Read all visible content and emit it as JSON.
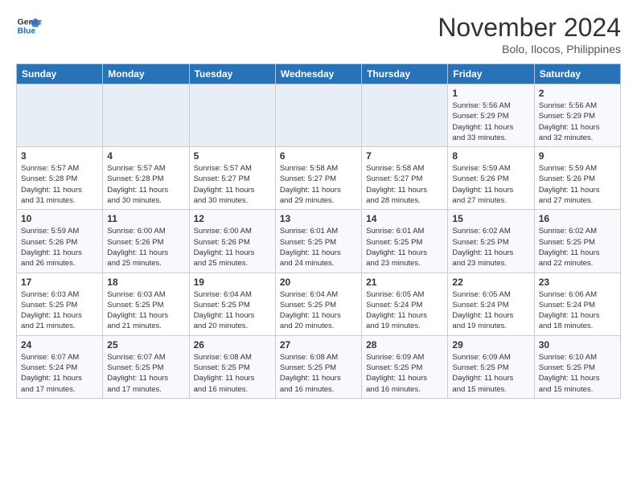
{
  "logo": {
    "line1": "General",
    "line2": "Blue"
  },
  "title": "November 2024",
  "subtitle": "Bolo, Ilocos, Philippines",
  "weekdays": [
    "Sunday",
    "Monday",
    "Tuesday",
    "Wednesday",
    "Thursday",
    "Friday",
    "Saturday"
  ],
  "weeks": [
    [
      {
        "day": "",
        "info": ""
      },
      {
        "day": "",
        "info": ""
      },
      {
        "day": "",
        "info": ""
      },
      {
        "day": "",
        "info": ""
      },
      {
        "day": "",
        "info": ""
      },
      {
        "day": "1",
        "info": "Sunrise: 5:56 AM\nSunset: 5:29 PM\nDaylight: 11 hours\nand 33 minutes."
      },
      {
        "day": "2",
        "info": "Sunrise: 5:56 AM\nSunset: 5:29 PM\nDaylight: 11 hours\nand 32 minutes."
      }
    ],
    [
      {
        "day": "3",
        "info": "Sunrise: 5:57 AM\nSunset: 5:28 PM\nDaylight: 11 hours\nand 31 minutes."
      },
      {
        "day": "4",
        "info": "Sunrise: 5:57 AM\nSunset: 5:28 PM\nDaylight: 11 hours\nand 30 minutes."
      },
      {
        "day": "5",
        "info": "Sunrise: 5:57 AM\nSunset: 5:27 PM\nDaylight: 11 hours\nand 30 minutes."
      },
      {
        "day": "6",
        "info": "Sunrise: 5:58 AM\nSunset: 5:27 PM\nDaylight: 11 hours\nand 29 minutes."
      },
      {
        "day": "7",
        "info": "Sunrise: 5:58 AM\nSunset: 5:27 PM\nDaylight: 11 hours\nand 28 minutes."
      },
      {
        "day": "8",
        "info": "Sunrise: 5:59 AM\nSunset: 5:26 PM\nDaylight: 11 hours\nand 27 minutes."
      },
      {
        "day": "9",
        "info": "Sunrise: 5:59 AM\nSunset: 5:26 PM\nDaylight: 11 hours\nand 27 minutes."
      }
    ],
    [
      {
        "day": "10",
        "info": "Sunrise: 5:59 AM\nSunset: 5:26 PM\nDaylight: 11 hours\nand 26 minutes."
      },
      {
        "day": "11",
        "info": "Sunrise: 6:00 AM\nSunset: 5:26 PM\nDaylight: 11 hours\nand 25 minutes."
      },
      {
        "day": "12",
        "info": "Sunrise: 6:00 AM\nSunset: 5:26 PM\nDaylight: 11 hours\nand 25 minutes."
      },
      {
        "day": "13",
        "info": "Sunrise: 6:01 AM\nSunset: 5:25 PM\nDaylight: 11 hours\nand 24 minutes."
      },
      {
        "day": "14",
        "info": "Sunrise: 6:01 AM\nSunset: 5:25 PM\nDaylight: 11 hours\nand 23 minutes."
      },
      {
        "day": "15",
        "info": "Sunrise: 6:02 AM\nSunset: 5:25 PM\nDaylight: 11 hours\nand 23 minutes."
      },
      {
        "day": "16",
        "info": "Sunrise: 6:02 AM\nSunset: 5:25 PM\nDaylight: 11 hours\nand 22 minutes."
      }
    ],
    [
      {
        "day": "17",
        "info": "Sunrise: 6:03 AM\nSunset: 5:25 PM\nDaylight: 11 hours\nand 21 minutes."
      },
      {
        "day": "18",
        "info": "Sunrise: 6:03 AM\nSunset: 5:25 PM\nDaylight: 11 hours\nand 21 minutes."
      },
      {
        "day": "19",
        "info": "Sunrise: 6:04 AM\nSunset: 5:25 PM\nDaylight: 11 hours\nand 20 minutes."
      },
      {
        "day": "20",
        "info": "Sunrise: 6:04 AM\nSunset: 5:25 PM\nDaylight: 11 hours\nand 20 minutes."
      },
      {
        "day": "21",
        "info": "Sunrise: 6:05 AM\nSunset: 5:24 PM\nDaylight: 11 hours\nand 19 minutes."
      },
      {
        "day": "22",
        "info": "Sunrise: 6:05 AM\nSunset: 5:24 PM\nDaylight: 11 hours\nand 19 minutes."
      },
      {
        "day": "23",
        "info": "Sunrise: 6:06 AM\nSunset: 5:24 PM\nDaylight: 11 hours\nand 18 minutes."
      }
    ],
    [
      {
        "day": "24",
        "info": "Sunrise: 6:07 AM\nSunset: 5:24 PM\nDaylight: 11 hours\nand 17 minutes."
      },
      {
        "day": "25",
        "info": "Sunrise: 6:07 AM\nSunset: 5:25 PM\nDaylight: 11 hours\nand 17 minutes."
      },
      {
        "day": "26",
        "info": "Sunrise: 6:08 AM\nSunset: 5:25 PM\nDaylight: 11 hours\nand 16 minutes."
      },
      {
        "day": "27",
        "info": "Sunrise: 6:08 AM\nSunset: 5:25 PM\nDaylight: 11 hours\nand 16 minutes."
      },
      {
        "day": "28",
        "info": "Sunrise: 6:09 AM\nSunset: 5:25 PM\nDaylight: 11 hours\nand 16 minutes."
      },
      {
        "day": "29",
        "info": "Sunrise: 6:09 AM\nSunset: 5:25 PM\nDaylight: 11 hours\nand 15 minutes."
      },
      {
        "day": "30",
        "info": "Sunrise: 6:10 AM\nSunset: 5:25 PM\nDaylight: 11 hours\nand 15 minutes."
      }
    ]
  ]
}
